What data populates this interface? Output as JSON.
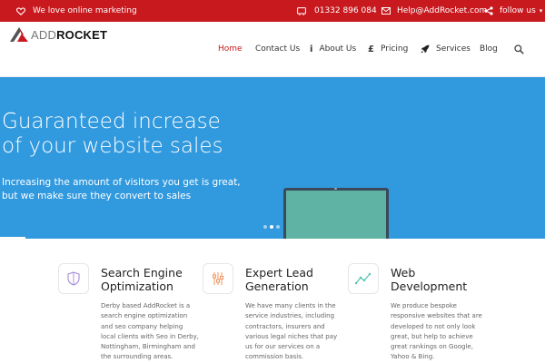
{
  "colors": {
    "topbar_bg": "#c8191f",
    "hero_bg": "#3199de",
    "active_nav": "#c8191f",
    "laptop_screen": "#5fb3a4"
  },
  "topbar": {
    "tagline": "We love online marketing",
    "tagline_icon": "heart-icon",
    "phone": "01332 896 084",
    "phone_icon": "phone-icon",
    "email": "Help@AddRocket.com",
    "email_icon": "envelope-icon",
    "follow": "follow us",
    "follow_icon": "share-icon",
    "follow_caret": "▾"
  },
  "header": {
    "logo_add": "ADD",
    "logo_rocket": "ROCKET",
    "logo_icon": "rocket-logo-icon",
    "nav": {
      "home": "Home",
      "contact": "Contact Us",
      "about": "About Us",
      "about_glyph": "i",
      "pricing": "Pricing",
      "pricing_glyph": "£",
      "services": "Services",
      "services_icon": "rocket-icon",
      "blog": "Blog",
      "search_icon": "search-icon"
    },
    "active_nav": "Home"
  },
  "hero": {
    "title_line1": "Guaranteed increase",
    "title_line2": "of your website sales",
    "sub_line1": "Increasing the amount of visitors you get is great,",
    "sub_line2": "but we make sure they convert to sales",
    "slides_total": 3,
    "slide_active": 1
  },
  "services": [
    {
      "icon": "shield-icon",
      "title_line1": "Search Engine",
      "title_line2": "Optimization",
      "text": [
        "Derby based AddRocket is a",
        "search engine optimization",
        "and seo company helping",
        "local clients with Seo in Derby,",
        "Nottingham, Birmingham and",
        "the surrounding areas."
      ]
    },
    {
      "icon": "tools-icon",
      "title_line1": "Expert Lead",
      "title_line2": "Generation",
      "text": [
        "We have many clients in the",
        "service industries, including",
        "contractors, insurers and",
        "various legal niches that pay",
        "us for our services on a",
        "commission basis."
      ]
    },
    {
      "icon": "line-chart-icon",
      "title_line1": "Web",
      "title_line2": "Development",
      "text": [
        "We produce bespoke",
        "responsive websites that are",
        "developed to not only look",
        "great, but help to achieve",
        "great rankings on Google,",
        "Yahoo & Bing."
      ]
    }
  ]
}
